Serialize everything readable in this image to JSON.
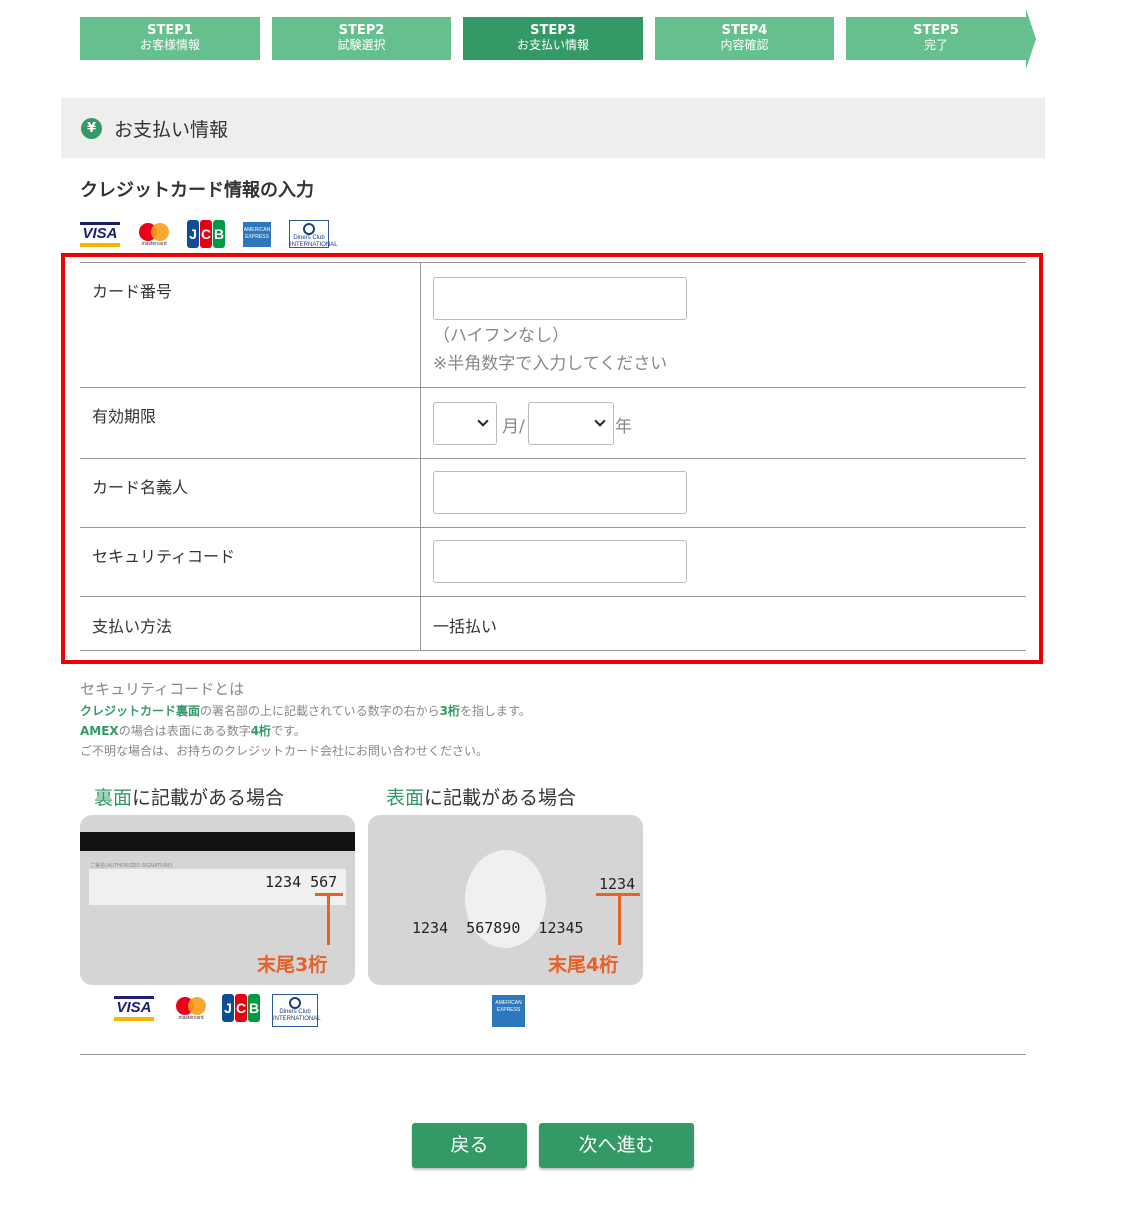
{
  "steps": [
    {
      "num": "STEP1",
      "label": "お客様情報",
      "active": false
    },
    {
      "num": "STEP2",
      "label": "試験選択",
      "active": false
    },
    {
      "num": "STEP3",
      "label": "お支払い情報",
      "active": true
    },
    {
      "num": "STEP4",
      "label": "内容確認",
      "active": false
    },
    {
      "num": "STEP5",
      "label": "完了",
      "active": false
    }
  ],
  "section": {
    "icon_glyph": "¥",
    "title": "お支払い情報"
  },
  "form_title": "クレジットカード情報の入力",
  "brands": {
    "visa": "VISA",
    "mastercard": "mastercard",
    "jcb": [
      "J",
      "C",
      "B"
    ],
    "amex": "AMERICAN EXPRESS",
    "diners": "Diners Club INTERNATIONAL"
  },
  "fields": {
    "card_number": {
      "label": "カード番号",
      "value": "",
      "hint1": "（ハイフンなし）",
      "hint2": "※半角数字で入力してください"
    },
    "expiry": {
      "label": "有効期限",
      "month_value": "",
      "month_unit": "月/",
      "year_value": "",
      "year_unit": "年"
    },
    "holder": {
      "label": "カード名義人",
      "value": ""
    },
    "security": {
      "label": "セキュリティコード",
      "value": ""
    },
    "payment_method": {
      "label": "支払い方法",
      "value": "一括払い"
    }
  },
  "security_info": {
    "title": "セキュリティコードとは",
    "line1": {
      "b1": "クレジットカード裏面",
      "t1": "の署名部の上に記載されている数字の右から",
      "b2": "3桁",
      "t2": "を指します。"
    },
    "line2": {
      "b1": "AMEX",
      "t1": "の場合は表面にある数字",
      "b2": "4桁",
      "t2": "です。"
    },
    "line3": "ご不明な場合は、お持ちのクレジットカード会社にお問い合わせください。"
  },
  "back_card": {
    "caption_highlight": "裏面",
    "caption_rest": "に記載がある場合",
    "sig_label": "ご署名(AUTHORIZED SIGNATURE)",
    "number": "1234 567",
    "note": "末尾3桁"
  },
  "front_card": {
    "caption_highlight": "表面",
    "caption_rest": "に記載がある場合",
    "code": "1234",
    "number": "1234  567890  12345",
    "note": "末尾4桁"
  },
  "buttons": {
    "back": "戻る",
    "next": "次へ進む"
  },
  "colors": {
    "accent": "#339966",
    "step": "#66bf8e",
    "highlight_border": "#f00000",
    "note_orange": "#e5622a"
  }
}
